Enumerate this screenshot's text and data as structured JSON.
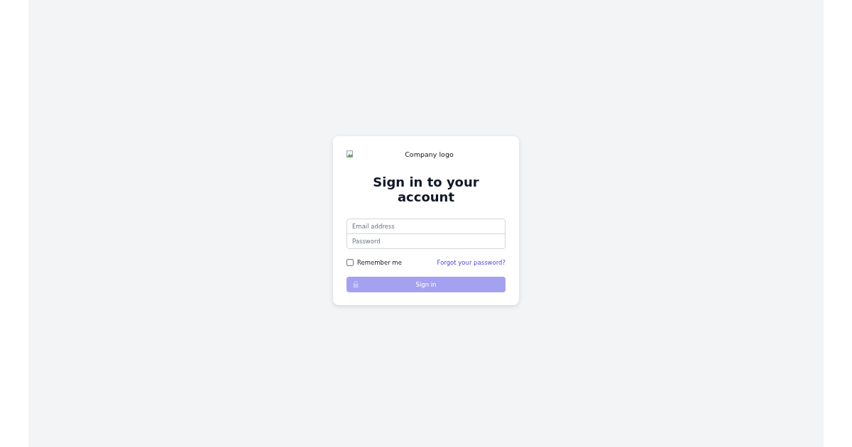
{
  "logo": {
    "alt": "Company logo"
  },
  "title": "Sign in to your account",
  "fields": [
    {
      "placeholder": "Email address"
    },
    {
      "placeholder": "Password"
    }
  ],
  "remember": {
    "label": "Remember me",
    "checked": false
  },
  "forgot_link": "Forgot your password?",
  "submit": {
    "label": "Sign in",
    "disabled": true
  }
}
